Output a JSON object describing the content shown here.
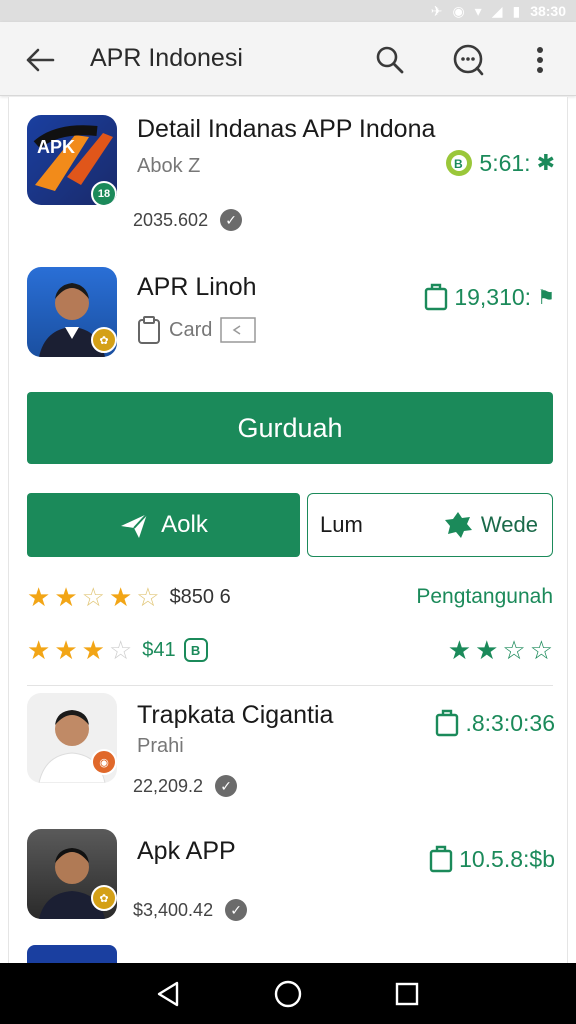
{
  "status_bar": {
    "time": "38:30"
  },
  "header": {
    "title": "APR Indonesi"
  },
  "apps": [
    {
      "name": "Detail Indanas APP Indona",
      "subtitle": "Abok Z",
      "count": "2035.602",
      "price": "5:61:",
      "badge": "18",
      "badge_color": "#1b8a5a"
    },
    {
      "name": "APR Linoh",
      "subtitle": "Card",
      "price": "19,310:",
      "badge": "",
      "badge_color": "#d4a017"
    },
    {
      "name": "Trapkata Cigantia",
      "subtitle": "Prahi",
      "count": "22,209.2",
      "price": ".8:3:0:36",
      "badge": "",
      "badge_color": "#e0682a"
    },
    {
      "name": "Apk APP",
      "count": "$3,400.42",
      "price": "10.5.8:$b",
      "badge": "",
      "badge_color": "#d4a017"
    }
  ],
  "buttons": {
    "primary": "Gurduah",
    "add": "Aolk",
    "outline_left": "Lum",
    "outline_right": "Wede"
  },
  "ratings": [
    {
      "value": "$850 6",
      "right_label": "Pengtangunah",
      "filled": 3.5
    },
    {
      "value": "$41",
      "filled": 3
    }
  ],
  "colors": {
    "accent": "#1b8a5a",
    "star": "#f2a516"
  }
}
